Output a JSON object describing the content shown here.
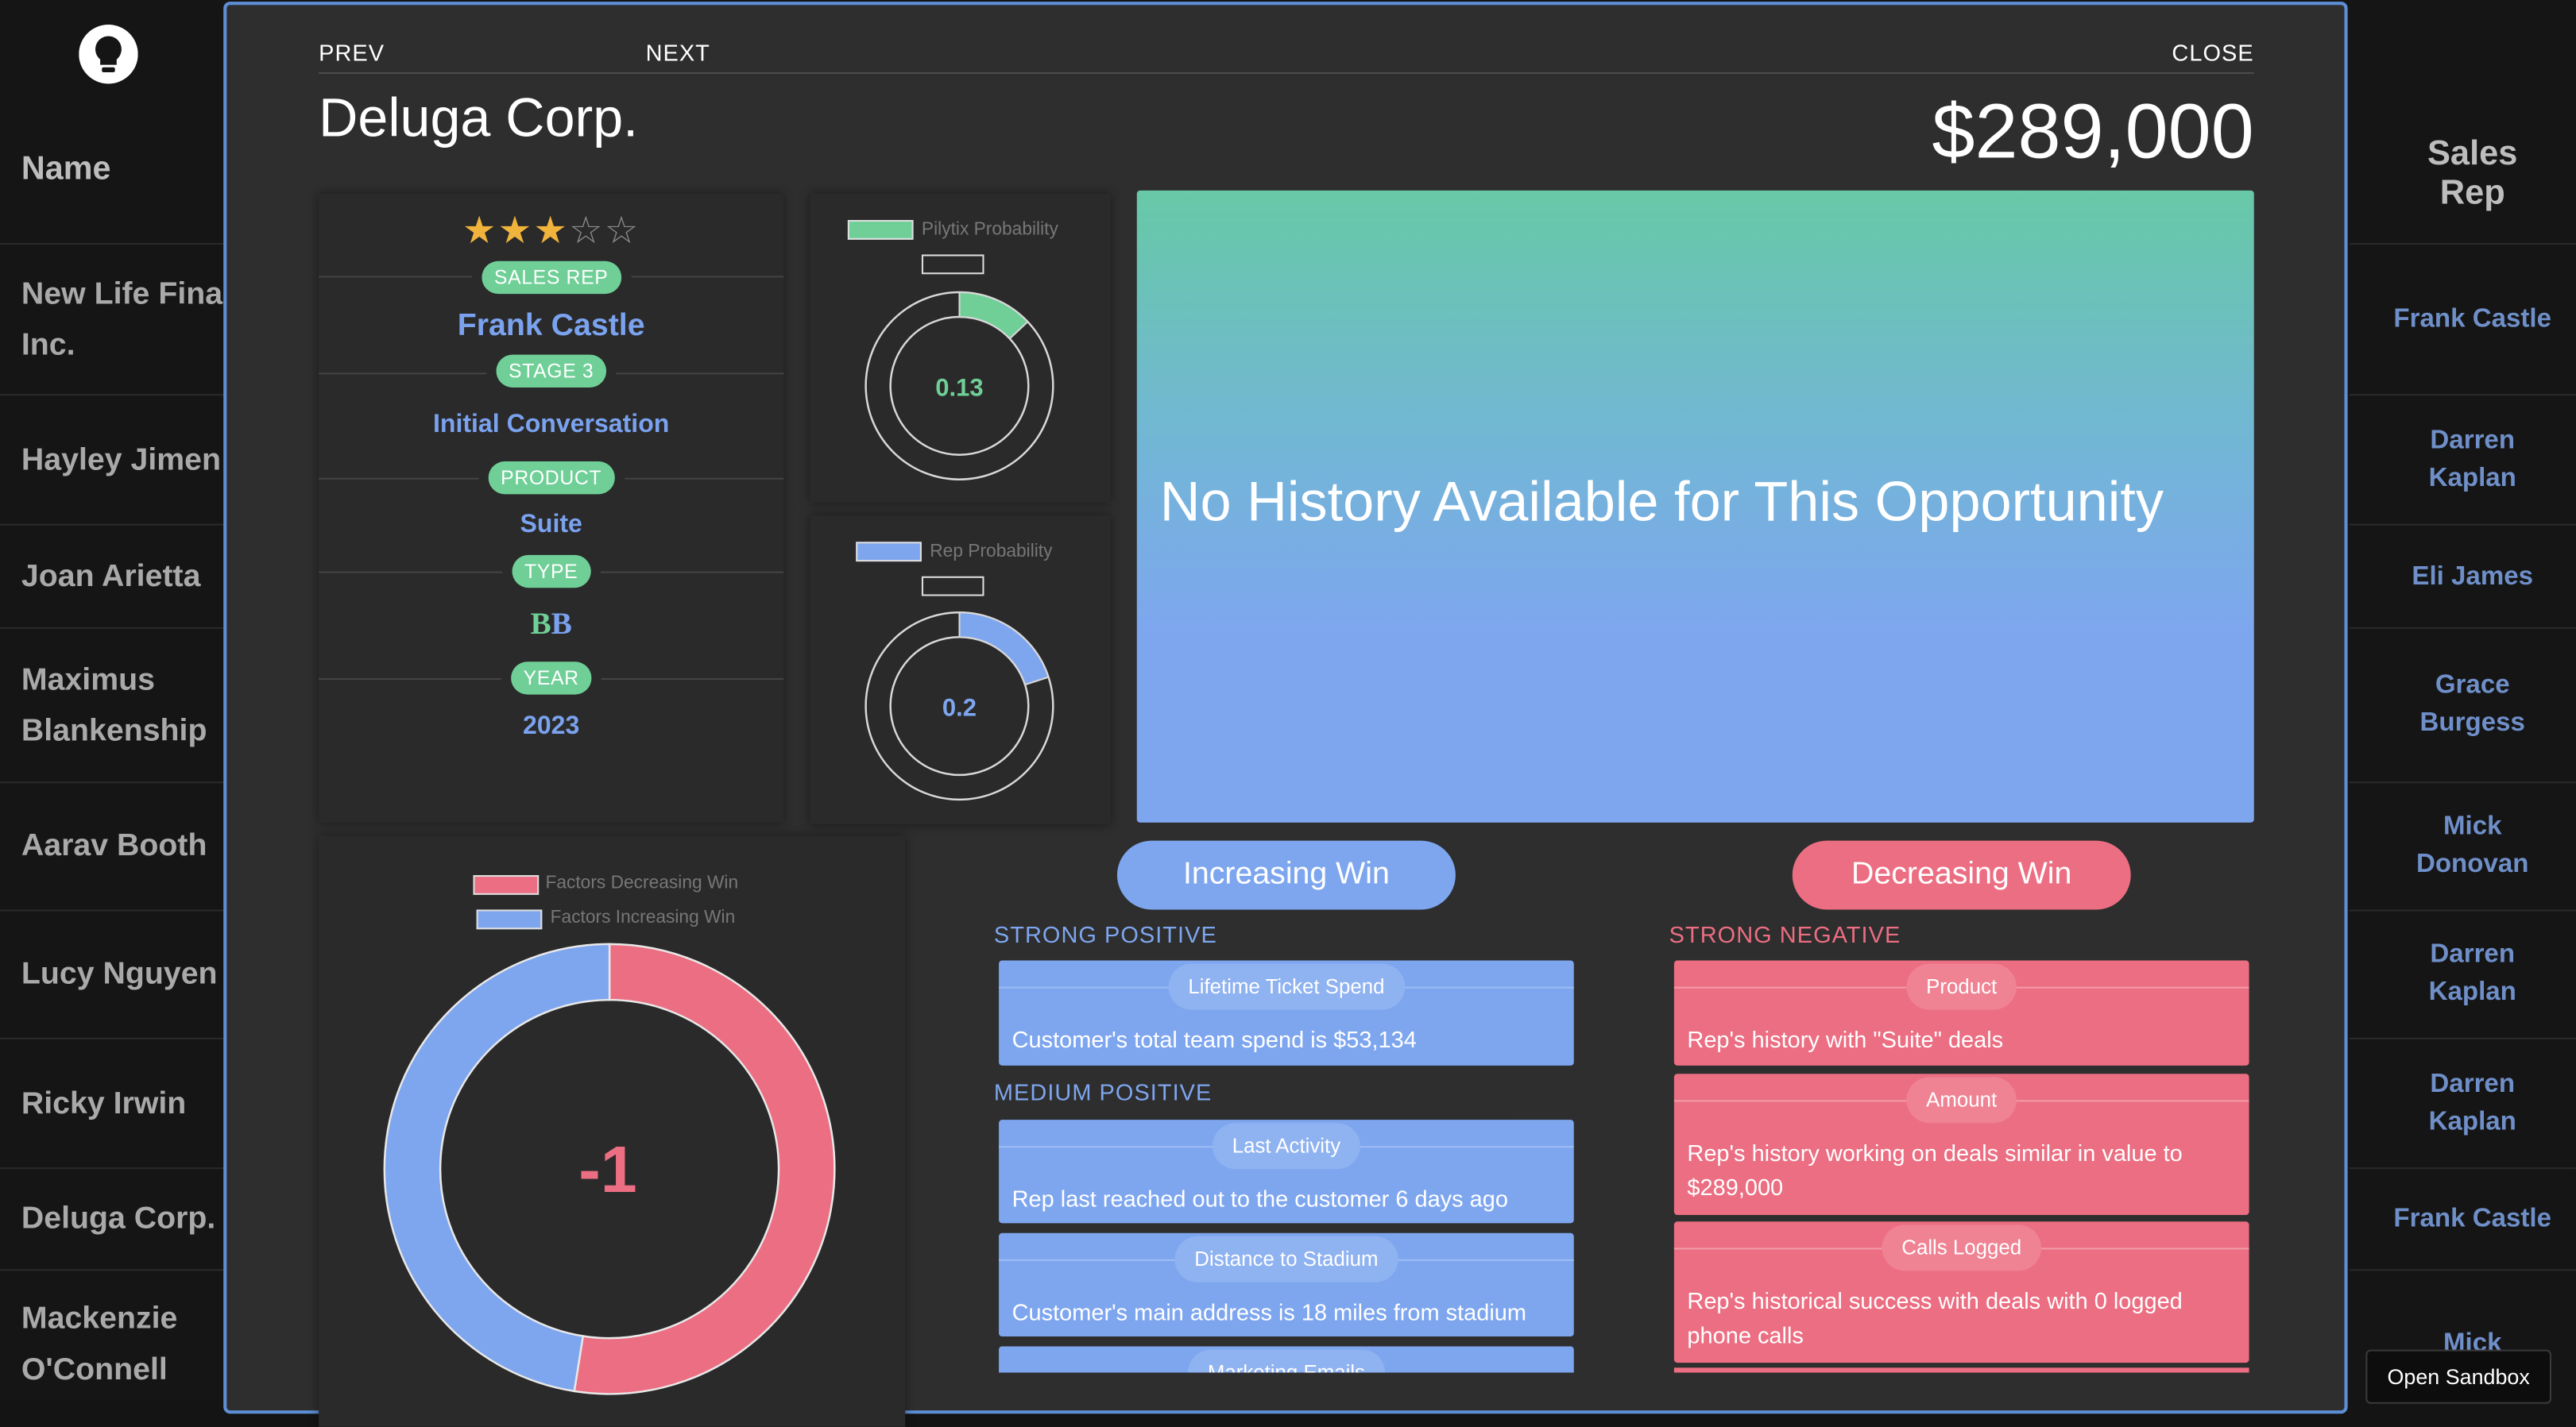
{
  "table": {
    "name_header": "Name",
    "rep_header_line1": "Sales",
    "rep_header_line2": "Rep",
    "rows": [
      {
        "name1": "New Life Fina",
        "name2": "Inc."
      },
      {
        "name1": "Hayley Jimen",
        "name2": ""
      },
      {
        "name1": "Joan Arietta",
        "name2": ""
      },
      {
        "name1": "Maximus",
        "name2": "Blankenship"
      },
      {
        "name1": "Aarav Booth",
        "name2": ""
      },
      {
        "name1": "Lucy Nguyen",
        "name2": ""
      },
      {
        "name1": "Ricky Irwin",
        "name2": ""
      },
      {
        "name1": "Deluga Corp.",
        "name2": ""
      },
      {
        "name1": "Mackenzie",
        "name2": "O'Connell"
      }
    ],
    "reps": [
      {
        "l1": "Frank Castle",
        "l2": ""
      },
      {
        "l1": "Darren",
        "l2": "Kaplan"
      },
      {
        "l1": "Eli James",
        "l2": ""
      },
      {
        "l1": "Grace",
        "l2": "Burgess"
      },
      {
        "l1": "Mick",
        "l2": "Donovan"
      },
      {
        "l1": "Darren",
        "l2": "Kaplan"
      },
      {
        "l1": "Darren",
        "l2": "Kaplan"
      },
      {
        "l1": "Frank Castle",
        "l2": ""
      },
      {
        "l1": "Mick",
        "l2": ""
      }
    ]
  },
  "modal": {
    "prev": "PREV",
    "next": "NEXT",
    "close": "CLOSE",
    "company": "Deluga Corp.",
    "amount": "$289,000",
    "rating": 3,
    "rating_max": 5,
    "sales_rep_label": "SALES REP",
    "sales_rep": "Frank Castle",
    "stage_label": "STAGE 3",
    "stage": "Initial Conversation",
    "product_label": "PRODUCT",
    "product": "Suite",
    "type_label": "TYPE",
    "type_left": "B",
    "type_right": "B",
    "year_label": "YEAR",
    "year": "2023",
    "pilytix_label": "Pilytix Probability",
    "pilytix_value": "0.13",
    "rep_label": "Rep Probability",
    "rep_value": "0.2",
    "history_text": "No History Available for This Opportunity",
    "donut_legend_dec": "Factors Decreasing Win",
    "donut_legend_inc": "Factors Increasing Win",
    "donut_value": "-1",
    "increasing_btn": "Increasing Win",
    "decreasing_btn": "Decreasing Win",
    "strong_positive": "STRONG POSITIVE",
    "medium_positive": "MEDIUM POSITIVE",
    "strong_negative": "STRONG NEGATIVE",
    "positive_factors": [
      {
        "tag": "Lifetime Ticket Spend",
        "desc": "Customer's total team spend is $53,134"
      },
      {
        "tag": "Last Activity",
        "desc": "Rep last reached out to the customer 6 days ago"
      },
      {
        "tag": "Distance to Stadium",
        "desc": "Customer's main address is 18 miles from stadium"
      },
      {
        "tag": "Marketing Emails",
        "desc": ""
      }
    ],
    "negative_factors": [
      {
        "tag": "Product",
        "desc": "Rep's history with \"Suite\" deals"
      },
      {
        "tag": "Amount",
        "desc": "Rep's history working on deals similar in value to $289,000"
      },
      {
        "tag": "Calls Logged",
        "desc": "Rep's historical success with deals with 0 logged phone calls"
      }
    ]
  },
  "chart_data": [
    {
      "type": "pie",
      "title": "",
      "series": [
        {
          "name": "Pilytix Probability",
          "values": [
            0.13
          ]
        }
      ]
    },
    {
      "type": "pie",
      "title": "",
      "series": [
        {
          "name": "Rep Probability",
          "values": [
            0.2
          ]
        }
      ]
    },
    {
      "type": "pie",
      "title": "",
      "categories": [
        "Factors Decreasing Win",
        "Factors Increasing Win"
      ],
      "values": [
        0.525,
        0.475
      ]
    }
  ],
  "colors": {
    "green": "#6fcf97",
    "blue": "#7ea6ef",
    "red": "#ec6e82",
    "accent_border": "#5d8fd6"
  },
  "footer": {
    "sandbox": "Open Sandbox"
  }
}
